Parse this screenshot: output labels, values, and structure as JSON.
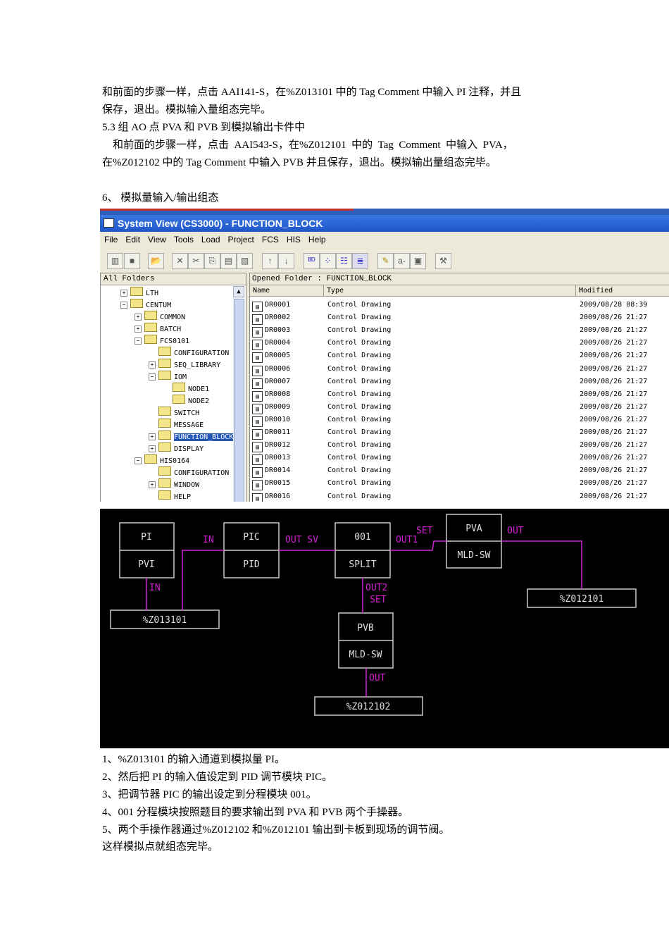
{
  "paragraphs_top": [
    "和前面的步骤一样，点击 AAI141-S，在%Z013101 中的 Tag Comment  中输入 PI 注释，并且",
    "保存，退出。模拟输入量组态完毕。",
    "5.3  组 AO 点 PVA 和 PVB 到模拟输出卡件中",
    "    和前面的步骤一样，点击  AAI543-S，在%Z012101  中的  Tag  Comment  中输入  PVA，",
    "在%Z012102 中的 Tag Comment  中输入 PVB 并且保存，退出。模拟输出量组态完毕。",
    "6、 模拟量输入/输出组态"
  ],
  "window": {
    "title": "System View (CS3000) - FUNCTION_BLOCK",
    "menu": [
      "File",
      "Edit",
      "View",
      "Tools",
      "Load",
      "Project",
      "FCS",
      "HIS",
      "Help"
    ],
    "tree_header": "All Folders",
    "tree": [
      {
        "label": "LTH",
        "level": 0,
        "pm": "+"
      },
      {
        "label": "CENTUM",
        "level": 0,
        "pm": "-"
      },
      {
        "label": "COMMON",
        "level": 1,
        "pm": "+"
      },
      {
        "label": "BATCH",
        "level": 1,
        "pm": "+"
      },
      {
        "label": "FCS0101",
        "level": 1,
        "pm": "-"
      },
      {
        "label": "CONFIGURATION",
        "level": 2,
        "pm": ""
      },
      {
        "label": "SEQ_LIBRARY",
        "level": 2,
        "pm": "+"
      },
      {
        "label": "IOM",
        "level": 2,
        "pm": "-"
      },
      {
        "label": "NODE1",
        "level": 3,
        "pm": ""
      },
      {
        "label": "NODE2",
        "level": 3,
        "pm": ""
      },
      {
        "label": "SWITCH",
        "level": 2,
        "pm": ""
      },
      {
        "label": "MESSAGE",
        "level": 2,
        "pm": ""
      },
      {
        "label": "FUNCTION_BLOCK",
        "level": 2,
        "pm": "+",
        "selected": true
      },
      {
        "label": "DISPLAY",
        "level": 2,
        "pm": "+"
      },
      {
        "label": "HIS0164",
        "level": 1,
        "pm": "-"
      },
      {
        "label": "CONFIGURATION",
        "level": 2,
        "pm": ""
      },
      {
        "label": "WINDOW",
        "level": 2,
        "pm": "+"
      },
      {
        "label": "HELP",
        "level": 2,
        "pm": ""
      }
    ],
    "list_header": "Opened Folder : FUNCTION_BLOCK",
    "columns": [
      "Name",
      "Type",
      "Modified"
    ],
    "rows": [
      [
        "DR0001",
        "Control Drawing",
        "2009/08/28 08:39"
      ],
      [
        "DR0002",
        "Control Drawing",
        "2009/08/26 21:27"
      ],
      [
        "DR0003",
        "Control Drawing",
        "2009/08/26 21:27"
      ],
      [
        "DR0004",
        "Control Drawing",
        "2009/08/26 21:27"
      ],
      [
        "DR0005",
        "Control Drawing",
        "2009/08/26 21:27"
      ],
      [
        "DR0006",
        "Control Drawing",
        "2009/08/26 21:27"
      ],
      [
        "DR0007",
        "Control Drawing",
        "2009/08/26 21:27"
      ],
      [
        "DR0008",
        "Control Drawing",
        "2009/08/26 21:27"
      ],
      [
        "DR0009",
        "Control Drawing",
        "2009/08/26 21:27"
      ],
      [
        "DR0010",
        "Control Drawing",
        "2009/08/26 21:27"
      ],
      [
        "DR0011",
        "Control Drawing",
        "2009/08/26 21:27"
      ],
      [
        "DR0012",
        "Control Drawing",
        "2009/08/26 21:27"
      ],
      [
        "DR0013",
        "Control Drawing",
        "2009/08/26 21:27"
      ],
      [
        "DR0014",
        "Control Drawing",
        "2009/08/26 21:27"
      ],
      [
        "DR0015",
        "Control Drawing",
        "2009/08/26 21:27"
      ],
      [
        "DR0016",
        "Control Drawing",
        "2009/08/26 21:27"
      ]
    ]
  },
  "diagram": {
    "colors": {
      "bg": "#000000",
      "box": "#c8c8c8",
      "wire": "#d020d0"
    },
    "blocks": {
      "pi": {
        "tag": "PI",
        "type": "PVI"
      },
      "pic": {
        "tag": "PIC",
        "type": "PID"
      },
      "split": {
        "tag": "001",
        "type": "SPLIT"
      },
      "pva": {
        "tag": "PVA",
        "type": "MLD-SW"
      },
      "pvb": {
        "tag": "PVB",
        "type": "MLD-SW"
      }
    },
    "io": {
      "z013101": "%Z013101",
      "z012101": "%Z012101",
      "z012102": "%Z012102"
    },
    "labels": {
      "in1": "IN",
      "in2": "IN",
      "out_sv": "OUT SV",
      "set1": "SET",
      "out1": "OUT1",
      "out_pva": "OUT",
      "out2": "OUT2",
      "set2": "SET",
      "out_pvb": "OUT"
    }
  },
  "paragraphs_bottom": [
    "1、%Z013101 的输入通道到模拟量 PI。",
    "2、然后把 PI 的输入值设定到 PID 调节模块 PIC。",
    "3、把调节器 PIC 的输出设定到分程模块 001。",
    "4、001 分程模块按照题目的要求输出到 PVA 和 PVB 两个手操器。",
    "5、两个手操作器通过%Z012102 和%Z012101 输出到卡板到现场的调节阀。",
    "这样模拟点就组态完毕。"
  ]
}
